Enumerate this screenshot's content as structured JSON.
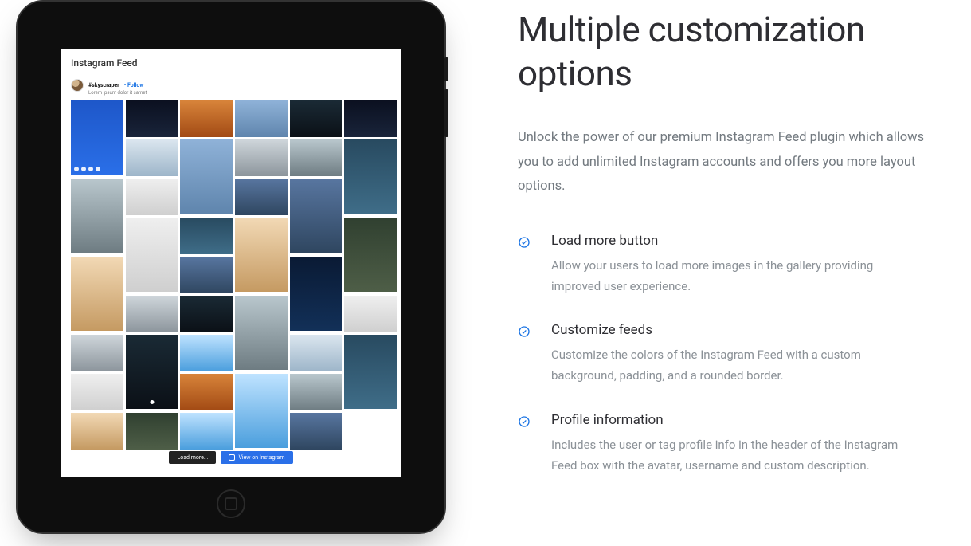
{
  "ipad": {
    "feed_title": "Instagram Feed",
    "profile": {
      "handle": "#skyscraper",
      "follow_label": "• Follow",
      "description": "Lorem ipsum dolor it samet"
    },
    "load_more_label": "Load more...",
    "view_label": "View on Instagram"
  },
  "content": {
    "title": "Multiple customization options",
    "lead": "Unlock the power of our premium Instagram Feed plugin which allows you to add unlimited Instagram accounts and offers you more layout options.",
    "features": [
      {
        "title": "Load more button",
        "desc": "Allow your users to load more images in the gallery providing improved user experience."
      },
      {
        "title": "Customize feeds",
        "desc": "Customize the colors of the Instagram Feed with a custom background, padding, and a rounded border."
      },
      {
        "title": "Profile information",
        "desc": "Includes the user or tag profile info in the header of the Instagram Feed box with the avatar, username and custom description."
      }
    ]
  }
}
